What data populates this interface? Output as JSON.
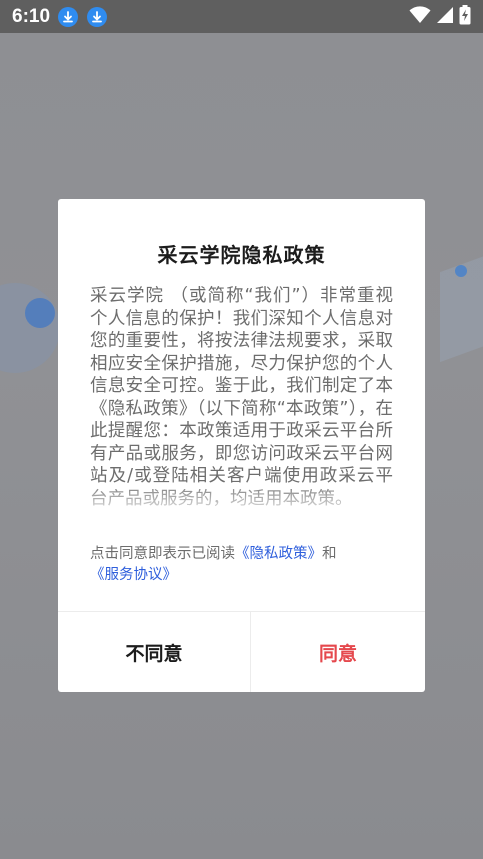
{
  "status_bar": {
    "time": "6:10",
    "icons": [
      "download-icon",
      "download-icon",
      "wifi-icon",
      "signal-icon",
      "battery-charging-icon"
    ]
  },
  "dialog": {
    "title": "采云学院隐私政策",
    "body": "采云学院 （或简称“我们”）非常重视个人信息的保护！我们深知个人信息对您的重要性，将按法律法规要求，采取相应安全保护措施，尽力保护您的个人信息安全可控。鉴于此，我们制定了本《隐私政策》（以下简称“本政策”），在此提醒您：本政策适用于政采云平台所有产品或服务，即您访问政采云平台网站及/或登陆相关客户端使用政采云平台产品或服务的，均适用本政策。",
    "consent_prefix": "点击同意即表示已阅读",
    "privacy_link": "《隐私政策》",
    "consent_and": "和",
    "service_link": "《服务协议》",
    "disagree_label": "不同意",
    "agree_label": "同意"
  },
  "colors": {
    "link": "#2f5fdc",
    "agree": "#e5484d",
    "status_bar": "#5f5f5f",
    "download_badge": "#2f8cf0"
  }
}
